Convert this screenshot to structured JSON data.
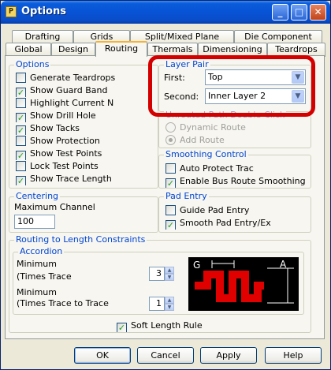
{
  "window": {
    "title": "Options",
    "icon": "app-icon"
  },
  "titlebar_buttons": {
    "minimize": "_",
    "maximize": "□",
    "close": "✕"
  },
  "tabs_row1": [
    "Drafting",
    "Grids",
    "Split/Mixed Plane",
    "Die Component"
  ],
  "tabs_row2": [
    "Global",
    "Design",
    "Routing",
    "Thermals",
    "Dimensioning",
    "Teardrops"
  ],
  "active_tab": "Routing",
  "options": {
    "title": "Options",
    "items": [
      {
        "label": "Generate Teardrops",
        "checked": false
      },
      {
        "label": "Show Guard Band",
        "checked": true
      },
      {
        "label": "Highlight Current N",
        "checked": false
      },
      {
        "label": "Show Drill Hole",
        "checked": true
      },
      {
        "label": "Show Tacks",
        "checked": true
      },
      {
        "label": "Show Protection",
        "checked": false
      },
      {
        "label": "Show Test Points",
        "checked": true
      },
      {
        "label": "Lock Test Points",
        "checked": false
      },
      {
        "label": "Show Trace Length",
        "checked": true
      }
    ]
  },
  "layer_pair": {
    "title": "Layer Pair",
    "first_label": "First:",
    "first_value": "Top",
    "second_label": "Second:",
    "second_value": "Inner Layer 2"
  },
  "unrouted": {
    "title": "Unrouted Path Double-Click",
    "options": [
      "Dynamic Route",
      "Add Route"
    ],
    "selected": "Add Route"
  },
  "smoothing": {
    "title": "Smoothing Control",
    "items": [
      {
        "label": "Auto Protect Trac",
        "checked": false
      },
      {
        "label": "Enable Bus Route Smoothing",
        "checked": true
      }
    ]
  },
  "centering": {
    "title": "Centering",
    "label": "Maximum Channel",
    "value": "100"
  },
  "pad_entry": {
    "title": "Pad Entry",
    "items": [
      {
        "label": "Guide Pad Entry",
        "checked": false
      },
      {
        "label": "Smooth Pad Entry/Ex",
        "checked": true
      }
    ]
  },
  "routing_length": {
    "title": "Routing to Length Constraints",
    "accordion_title": "Accordion",
    "min1_label1": "Minimum",
    "min1_label2": "(Times Trace",
    "min1_value": "3",
    "min2_label1": "Minimum",
    "min2_label2": "(Times Trace to Trace",
    "min2_value": "1",
    "preview_label_g": "G",
    "preview_label_a": "A",
    "soft_length_rule": {
      "label": "Soft Length Rule",
      "checked": true
    }
  },
  "buttons": {
    "ok": "OK",
    "cancel": "Cancel",
    "apply": "Apply",
    "help": "Help"
  },
  "colors": {
    "title_blue": "#0a5cdb",
    "group_title": "#0046d5",
    "highlight_red": "#d40000",
    "trace_red": "#e00000",
    "check_green": "#21a121"
  }
}
